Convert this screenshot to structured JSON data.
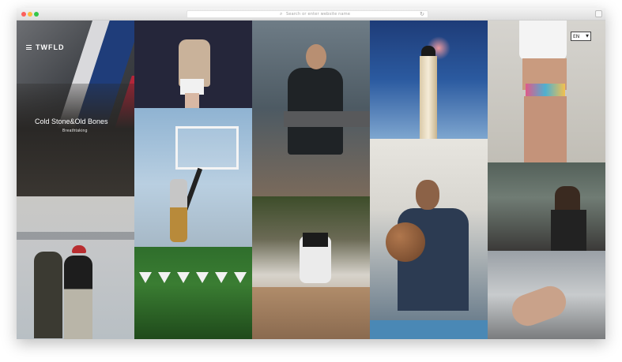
{
  "browser": {
    "address_placeholder": "Search or enter website name"
  },
  "site": {
    "logo": "TWFLD",
    "language": "EN"
  },
  "hero": {
    "title": "Cold Stone&Old Bones",
    "subtitle": "Breathtaking"
  },
  "icons": {
    "menu": "hamburger-menu-icon",
    "search": "search-icon",
    "reload": "reload-icon",
    "caret": "chevron-down-icon"
  },
  "colors": {
    "overlay_text": "#ffffff",
    "traffic_red": "#fc605c",
    "traffic_yellow": "#fdbc40",
    "traffic_green": "#34c749"
  }
}
